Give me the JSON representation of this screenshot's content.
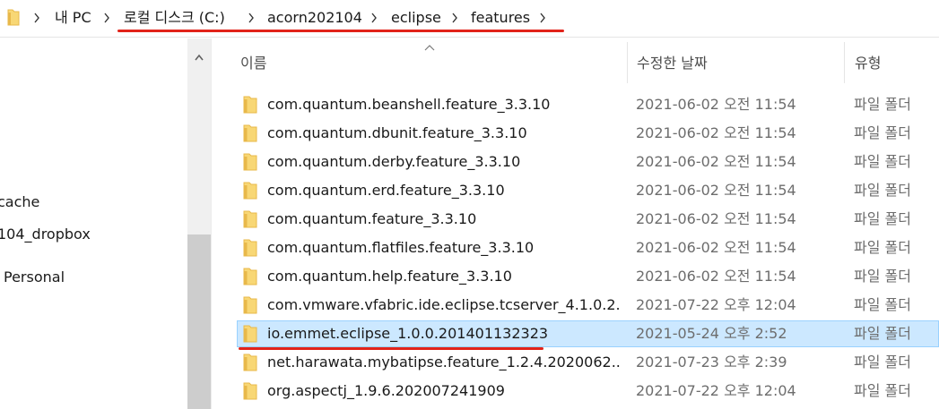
{
  "breadcrumb": {
    "items": [
      "내 PC",
      "로컬 디스크 (C:)",
      "acorn202104",
      "eclipse",
      "features"
    ]
  },
  "nav": {
    "items": [
      "cache",
      "104_dropbox",
      "Personal"
    ]
  },
  "columns": {
    "name": "이름",
    "date": "수정한 날짜",
    "type": "유형"
  },
  "files": [
    {
      "name": "com.quantum.beanshell.feature_3.3.10",
      "date": "2021-06-02 오전 11:54",
      "type": "파일 폴더"
    },
    {
      "name": "com.quantum.dbunit.feature_3.3.10",
      "date": "2021-06-02 오전 11:54",
      "type": "파일 폴더"
    },
    {
      "name": "com.quantum.derby.feature_3.3.10",
      "date": "2021-06-02 오전 11:54",
      "type": "파일 폴더"
    },
    {
      "name": "com.quantum.erd.feature_3.3.10",
      "date": "2021-06-02 오전 11:54",
      "type": "파일 폴더"
    },
    {
      "name": "com.quantum.feature_3.3.10",
      "date": "2021-06-02 오전 11:54",
      "type": "파일 폴더"
    },
    {
      "name": "com.quantum.flatfiles.feature_3.3.10",
      "date": "2021-06-02 오전 11:54",
      "type": "파일 폴더"
    },
    {
      "name": "com.quantum.help.feature_3.3.10",
      "date": "2021-06-02 오전 11:54",
      "type": "파일 폴더"
    },
    {
      "name": "com.vmware.vfabric.ide.eclipse.tcserver_4.1.0.2...",
      "date": "2021-07-22 오후 12:04",
      "type": "파일 폴더"
    },
    {
      "name": "io.emmet.eclipse_1.0.0.201401132323",
      "date": "2021-05-24 오후 2:52",
      "type": "파일 폴더",
      "selected": true
    },
    {
      "name": "net.harawata.mybatipse.feature_1.2.4.2020062...",
      "date": "2021-07-23 오후 2:39",
      "type": "파일 폴더"
    },
    {
      "name": "org.aspectj_1.9.6.202007241909",
      "date": "2021-07-22 오후 12:04",
      "type": "파일 폴더"
    }
  ],
  "colors": {
    "folder": "#f8d775",
    "folder_dark": "#e8b84a",
    "selection": "#cce8ff",
    "annotation": "#e2231a"
  },
  "icons": {
    "folder": "folder-icon",
    "separator": "chevron-right-icon",
    "sort": "sort-ascending-icon",
    "scroll_up": "scroll-up-arrow-icon"
  }
}
